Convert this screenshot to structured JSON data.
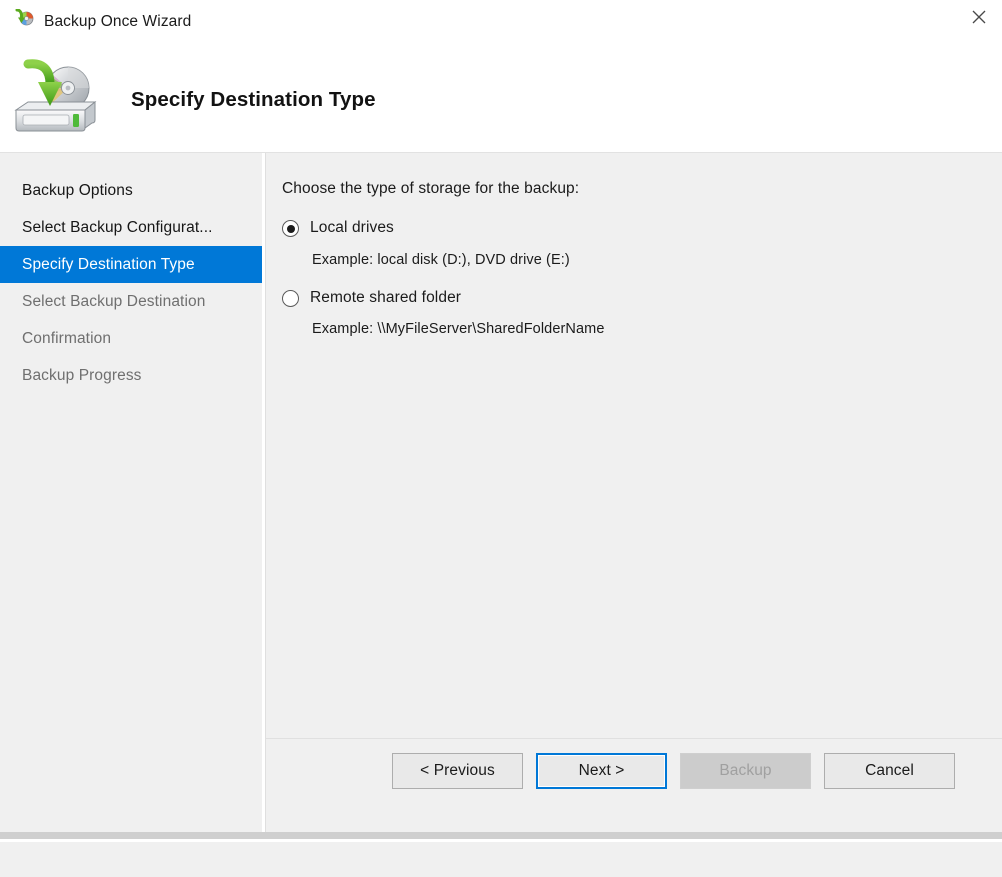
{
  "window": {
    "title": "Backup Once Wizard",
    "title_icon": "backup-disc-icon",
    "close_icon": "close-icon"
  },
  "header": {
    "icon": "backup-drive-disc-icon",
    "title": "Specify Destination Type"
  },
  "sidebar": {
    "items": [
      {
        "label": "Backup Options",
        "state": "done"
      },
      {
        "label": "Select Backup Configurat...",
        "state": "done"
      },
      {
        "label": "Specify Destination Type",
        "state": "active"
      },
      {
        "label": "Select Backup Destination",
        "state": "todo"
      },
      {
        "label": "Confirmation",
        "state": "todo"
      },
      {
        "label": "Backup Progress",
        "state": "todo"
      }
    ]
  },
  "content": {
    "prompt": "Choose the type of storage for the backup:",
    "options": [
      {
        "label": "Local drives",
        "selected": true,
        "example": "Example: local disk (D:), DVD drive (E:)"
      },
      {
        "label": "Remote shared folder",
        "selected": false,
        "example": "Example: \\\\MyFileServer\\SharedFolderName"
      }
    ]
  },
  "buttons": {
    "previous": "< Previous",
    "next": "Next >",
    "backup": "Backup",
    "cancel": "Cancel"
  },
  "colors": {
    "accent": "#0078d7",
    "body_background": "#f0f0f0",
    "header_background": "#ffffff",
    "text": "#1b1b1b",
    "text_disabled": "#6f6f6f",
    "button_face": "#e9e9e9",
    "button_disabled": "#cccccc"
  }
}
